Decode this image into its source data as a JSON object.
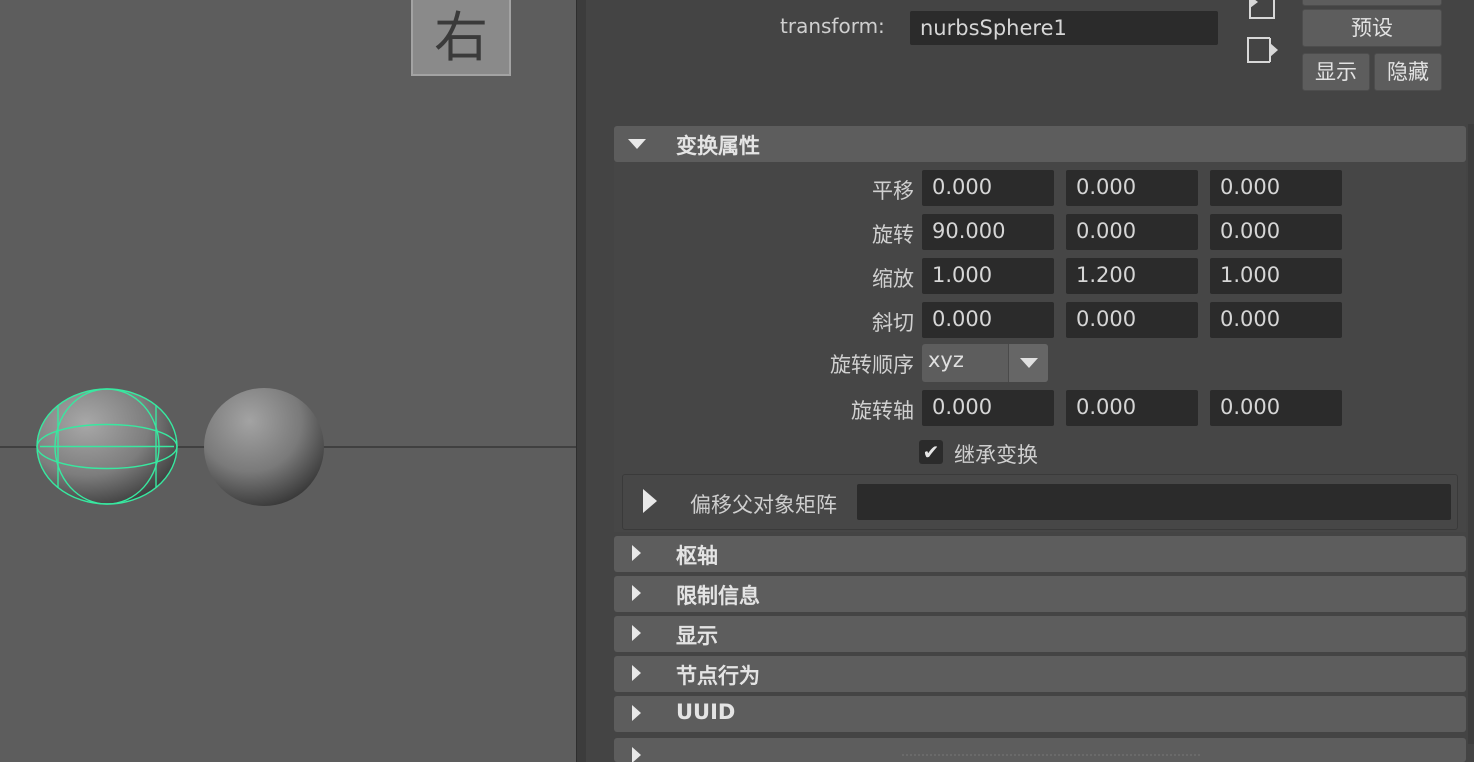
{
  "viewport": {
    "view_label": "右"
  },
  "header": {
    "node_type_label": "transform:",
    "node_name": "nurbsSphere1",
    "presets_button": "预设",
    "show_button": "显示",
    "hide_button": "隐藏"
  },
  "sections": {
    "transform_attrs": {
      "label": "变换属性",
      "rows": [
        {
          "label": "平移",
          "values": [
            "0.000",
            "0.000",
            "0.000"
          ]
        },
        {
          "label": "旋转",
          "values": [
            "90.000",
            "0.000",
            "0.000"
          ]
        },
        {
          "label": "缩放",
          "values": [
            "1.000",
            "1.200",
            "1.000"
          ]
        },
        {
          "label": "斜切",
          "values": [
            "0.000",
            "0.000",
            "0.000"
          ]
        }
      ],
      "rotate_order": {
        "label": "旋转顺序",
        "value": "xyz"
      },
      "rotate_axis": {
        "label": "旋转轴",
        "values": [
          "0.000",
          "0.000",
          "0.000"
        ]
      },
      "inherits_transform": {
        "label": "继承变换",
        "checked": true,
        "check_glyph": "✔"
      },
      "offset_parent_matrix": {
        "label": "偏移父对象矩阵"
      }
    },
    "collapsed": [
      {
        "label": "枢轴"
      },
      {
        "label": "限制信息"
      },
      {
        "label": "显示"
      },
      {
        "label": "节点行为"
      },
      {
        "label": "UUID"
      }
    ]
  },
  "colors": {
    "viewport_bg": "#5d5d5d",
    "panel_bg": "#444444",
    "field_bg": "#2b2b2b",
    "selection_wire": "#38e8a0"
  }
}
